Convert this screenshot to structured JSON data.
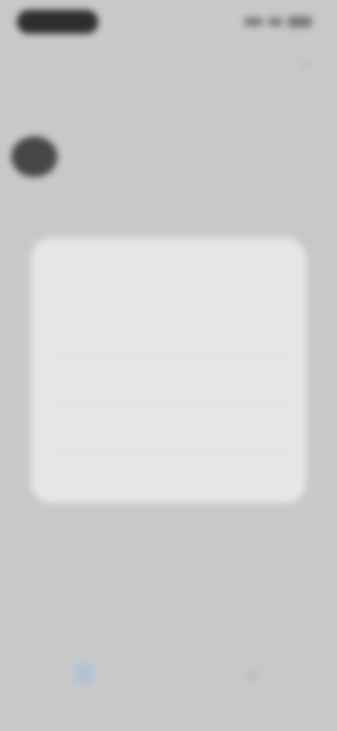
{
  "status_bar": {
    "time": "",
    "icons": [
      "signal-icon",
      "wifi-icon",
      "battery-icon"
    ]
  },
  "header": {
    "title": "",
    "subtitle": "",
    "action_icon": "add-icon",
    "action_glyph": "+"
  },
  "profile": {
    "name": ""
  },
  "dialog": {
    "title": "",
    "body": "",
    "buttons": [
      {
        "label": ""
      },
      {
        "label": ""
      },
      {
        "label": ""
      }
    ]
  },
  "bottom": {
    "title": "",
    "subtitle": "",
    "link": ""
  },
  "tab_bar": {
    "tabs": [
      {
        "label": "",
        "icon": "home-icon",
        "glyph": "⌂",
        "selected": true
      },
      {
        "label": "",
        "icon": "person-icon",
        "glyph": "☺",
        "selected": false
      }
    ]
  },
  "colors": {
    "accent": "#8aa8c8",
    "dialog_bg": "#e6e6e6",
    "backdrop": "#c8c8c8"
  }
}
